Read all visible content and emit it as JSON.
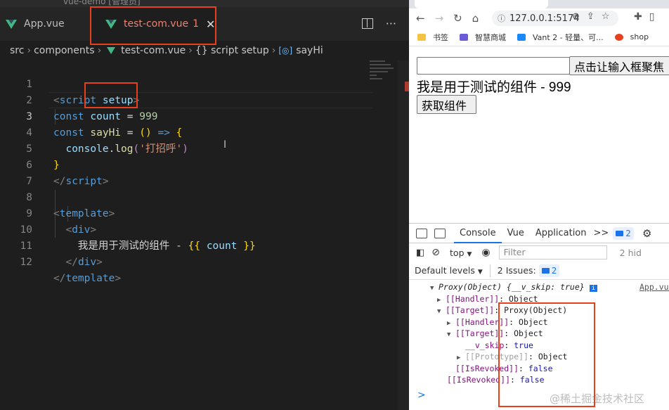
{
  "editor": {
    "window_title": "vue-demo [管理员]",
    "tabs": [
      {
        "label": "App.vue"
      },
      {
        "label": "test-com.vue",
        "badge": "1"
      }
    ],
    "breadcrumb": [
      "src",
      "components",
      "test-com.vue",
      "{} script setup",
      "sayHi"
    ],
    "lines": [
      {
        "no": "1"
      },
      {
        "no": "2"
      },
      {
        "no": "3"
      },
      {
        "no": "4"
      },
      {
        "no": "5"
      },
      {
        "no": "6"
      },
      {
        "no": "7"
      },
      {
        "no": "8"
      },
      {
        "no": "9"
      },
      {
        "no": "10"
      },
      {
        "no": "11"
      },
      {
        "no": "12"
      }
    ],
    "code": {
      "l1_open": "<",
      "l1_tag": "script",
      "l1_attr": "setup",
      "l1_close": ">",
      "l2_kw": "const",
      "l2_var": "count",
      "l2_eq": "=",
      "l2_num": "999",
      "l3_kw": "const",
      "l3_var": "sayHi",
      "l3_eq": "=",
      "l3_parens": "()",
      "l3_arrow": "=>",
      "l3_brace": "{",
      "l4_obj": "console",
      "l4_dot": ".",
      "l4_fn": "log",
      "l4_lp": "(",
      "l4_str": "'打招呼'",
      "l4_rp": ")",
      "l5_brace": "}",
      "l6_open": "</",
      "l6_tag": "script",
      "l6_close": ">",
      "l8_open": "<",
      "l8_tag": "template",
      "l8_close": ">",
      "l9_open": "<",
      "l9_tag": "div",
      "l9_close": ">",
      "l10_text": "我是用于测试的组件 - ",
      "l10_lb": "{{",
      "l10_var": "count",
      "l10_rb": "}}",
      "l11_open": "</",
      "l11_tag": "div",
      "l11_close": ">",
      "l12_open": "</",
      "l12_tag": "template",
      "l12_close": ">"
    },
    "cursor_glyph": "I"
  },
  "browser": {
    "url": "127.0.0.1:5174",
    "bookmarks": [
      "书签",
      "智慧商城",
      "Vant 2 - 轻量、可...",
      "shop"
    ],
    "page": {
      "focus_button": "点击让输入框聚焦",
      "component_text": "我是用于测试的组件 - 999",
      "get_button": "获取组件"
    }
  },
  "devtools": {
    "tabs": [
      "Console",
      "Vue",
      "Application"
    ],
    "more": ">>",
    "issues_badge": "2",
    "context": "top",
    "filter_placeholder": "Filter",
    "hidden_count": "2 hid",
    "levels": "Default levels",
    "issues_label": "2 Issues:",
    "issues_count": "2",
    "source_link": "App.vue",
    "log": {
      "l1": "Proxy(Object) {__v_skip: true}",
      "l2_key": "[[Handler]]",
      "l2_val": "Object",
      "l3_key": "[[Target]]",
      "l3_val": "Proxy(Object)",
      "l4_key": "[[Handler]]",
      "l4_val": "Object",
      "l5_key": "[[Target]]",
      "l5_val": "Object",
      "l6_key": "__v_skip",
      "l6_val": "true",
      "l7_key": "[[Prototype]]",
      "l7_val": "Object",
      "l8_key": "[[IsRevoked]]",
      "l8_val": "false",
      "l9_key": "[[IsRevoked]]",
      "l9_val": "false"
    },
    "prompt": ">"
  },
  "watermark": "@稀土掘金技术社区",
  "colors": {
    "editor_bg": "#1e1e1e",
    "highlight_box": "#e8401c",
    "vue_green": "#41b883",
    "accent_blue": "#1a73e8"
  }
}
